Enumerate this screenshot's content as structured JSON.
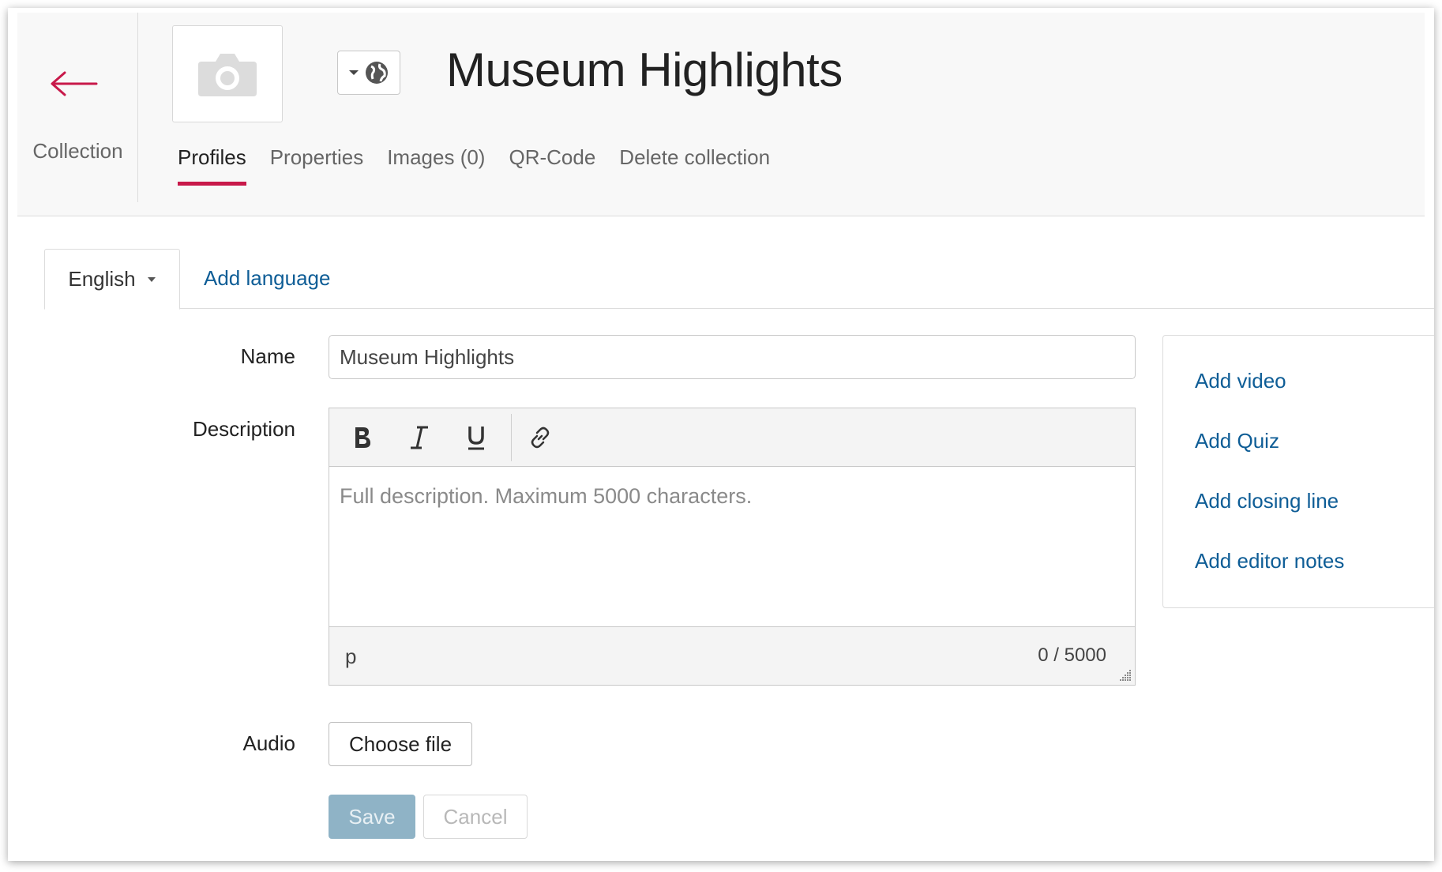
{
  "header": {
    "back_label": "Collection",
    "title": "Museum Highlights",
    "tabs": [
      {
        "label": "Profiles",
        "active": true
      },
      {
        "label": "Properties",
        "active": false
      },
      {
        "label": "Images (0)",
        "active": false
      },
      {
        "label": "QR-Code",
        "active": false
      },
      {
        "label": "Delete collection",
        "active": false
      }
    ],
    "icons": [
      "arrow-left-icon",
      "camera-icon",
      "caret-down-icon",
      "globe-icon"
    ]
  },
  "language": {
    "current": "English",
    "add_label": "Add language"
  },
  "form": {
    "name_label": "Name",
    "name_value": "Museum Highlights",
    "description_label": "Description",
    "description_placeholder": "Full description. Maximum 5000 characters.",
    "toolbar": [
      "bold-icon",
      "italic-icon",
      "underline-icon",
      "link-icon"
    ],
    "status_path": "p",
    "char_count": "0 / 5000",
    "audio_label": "Audio",
    "choose_file_label": "Choose file",
    "save_label": "Save",
    "cancel_label": "Cancel"
  },
  "side_panel": {
    "links": [
      "Add video",
      "Add Quiz",
      "Add closing line",
      "Add editor notes"
    ]
  },
  "colors": {
    "accent": "#c8194a",
    "link": "#0e5d96",
    "save_disabled": "#8fb3c6"
  }
}
